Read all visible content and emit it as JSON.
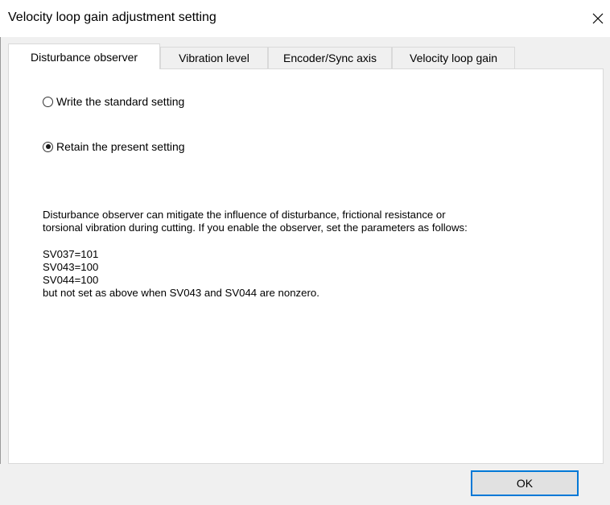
{
  "window": {
    "title": "Velocity loop gain adjustment setting"
  },
  "tabs": [
    {
      "label": "Disturbance observer",
      "active": true
    },
    {
      "label": "Vibration level",
      "active": false
    },
    {
      "label": "Encoder/Sync axis",
      "active": false
    },
    {
      "label": "Velocity loop gain",
      "active": false
    }
  ],
  "options": [
    {
      "label": "Write the standard setting",
      "selected": false
    },
    {
      "label": "Retain the present setting",
      "selected": true
    }
  ],
  "description": {
    "line1": "Disturbance observer can mitigate the influence of disturbance, frictional resistance or",
    "line2": "torsional vibration during cutting. If you enable the observer, set the parameters as follows:",
    "params": [
      "SV037=101",
      "SV043=100",
      "SV044=100"
    ],
    "note": "but not set as above when SV043 and SV044 are nonzero."
  },
  "buttons": {
    "ok_label": "OK"
  },
  "icons": {
    "close": "close-icon"
  },
  "colors": {
    "focus_border": "#0078d7",
    "tab_border": "#d9d9d9",
    "dialog_bg": "#f0f0f0"
  }
}
